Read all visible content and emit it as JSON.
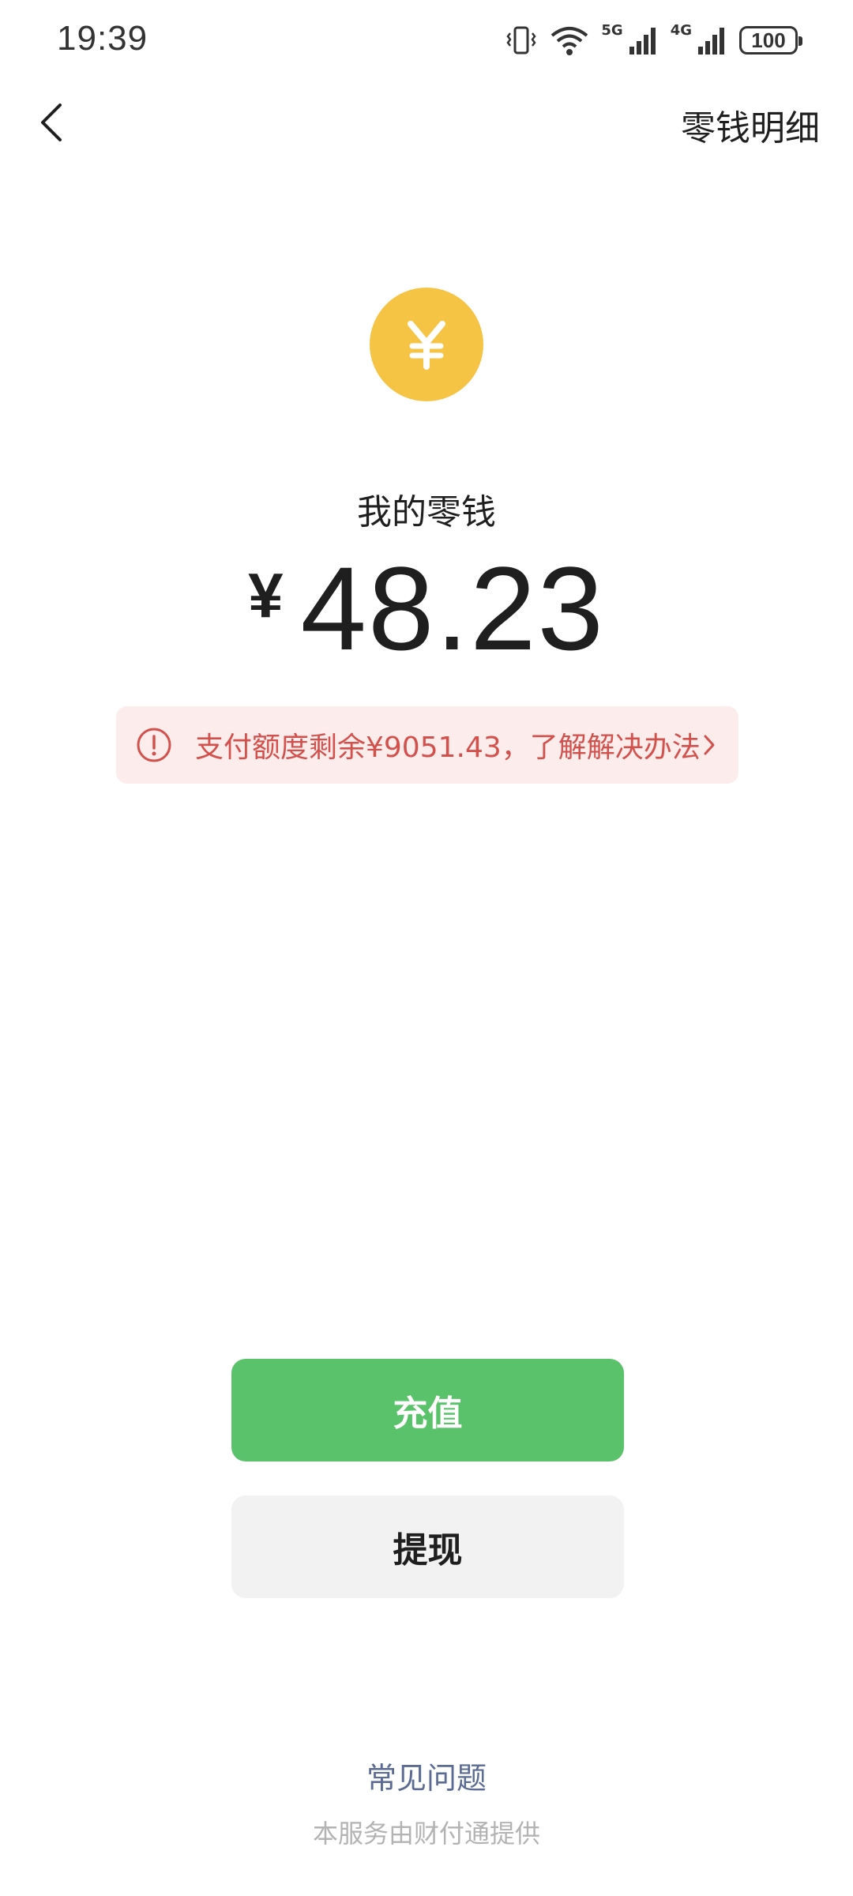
{
  "status_bar": {
    "time": "19:39",
    "network_5g": "5G",
    "network_4g": "4G",
    "battery": "100",
    "icons": [
      "vibrate-icon",
      "wifi-icon",
      "signal-5g-icon",
      "signal-4g-icon",
      "battery-icon"
    ]
  },
  "header": {
    "back_icon": "chevron-left-icon",
    "details_link": "零钱明细"
  },
  "wallet": {
    "coin_icon": "yuan-coin-icon",
    "coin_color": "#f6c445",
    "label": "我的零钱",
    "currency_symbol": "¥",
    "amount": "48.23"
  },
  "notice": {
    "icon": "alert-circle-icon",
    "text": "支付额度剩余¥9051.43，了解解决办法",
    "color": "#d3514d",
    "background": "#fcecec"
  },
  "actions": {
    "recharge_label": "充值",
    "recharge_color": "#5ac26b",
    "withdraw_label": "提现"
  },
  "footer": {
    "faq_label": "常见问题",
    "provider_note": "本服务由财付通提供"
  }
}
